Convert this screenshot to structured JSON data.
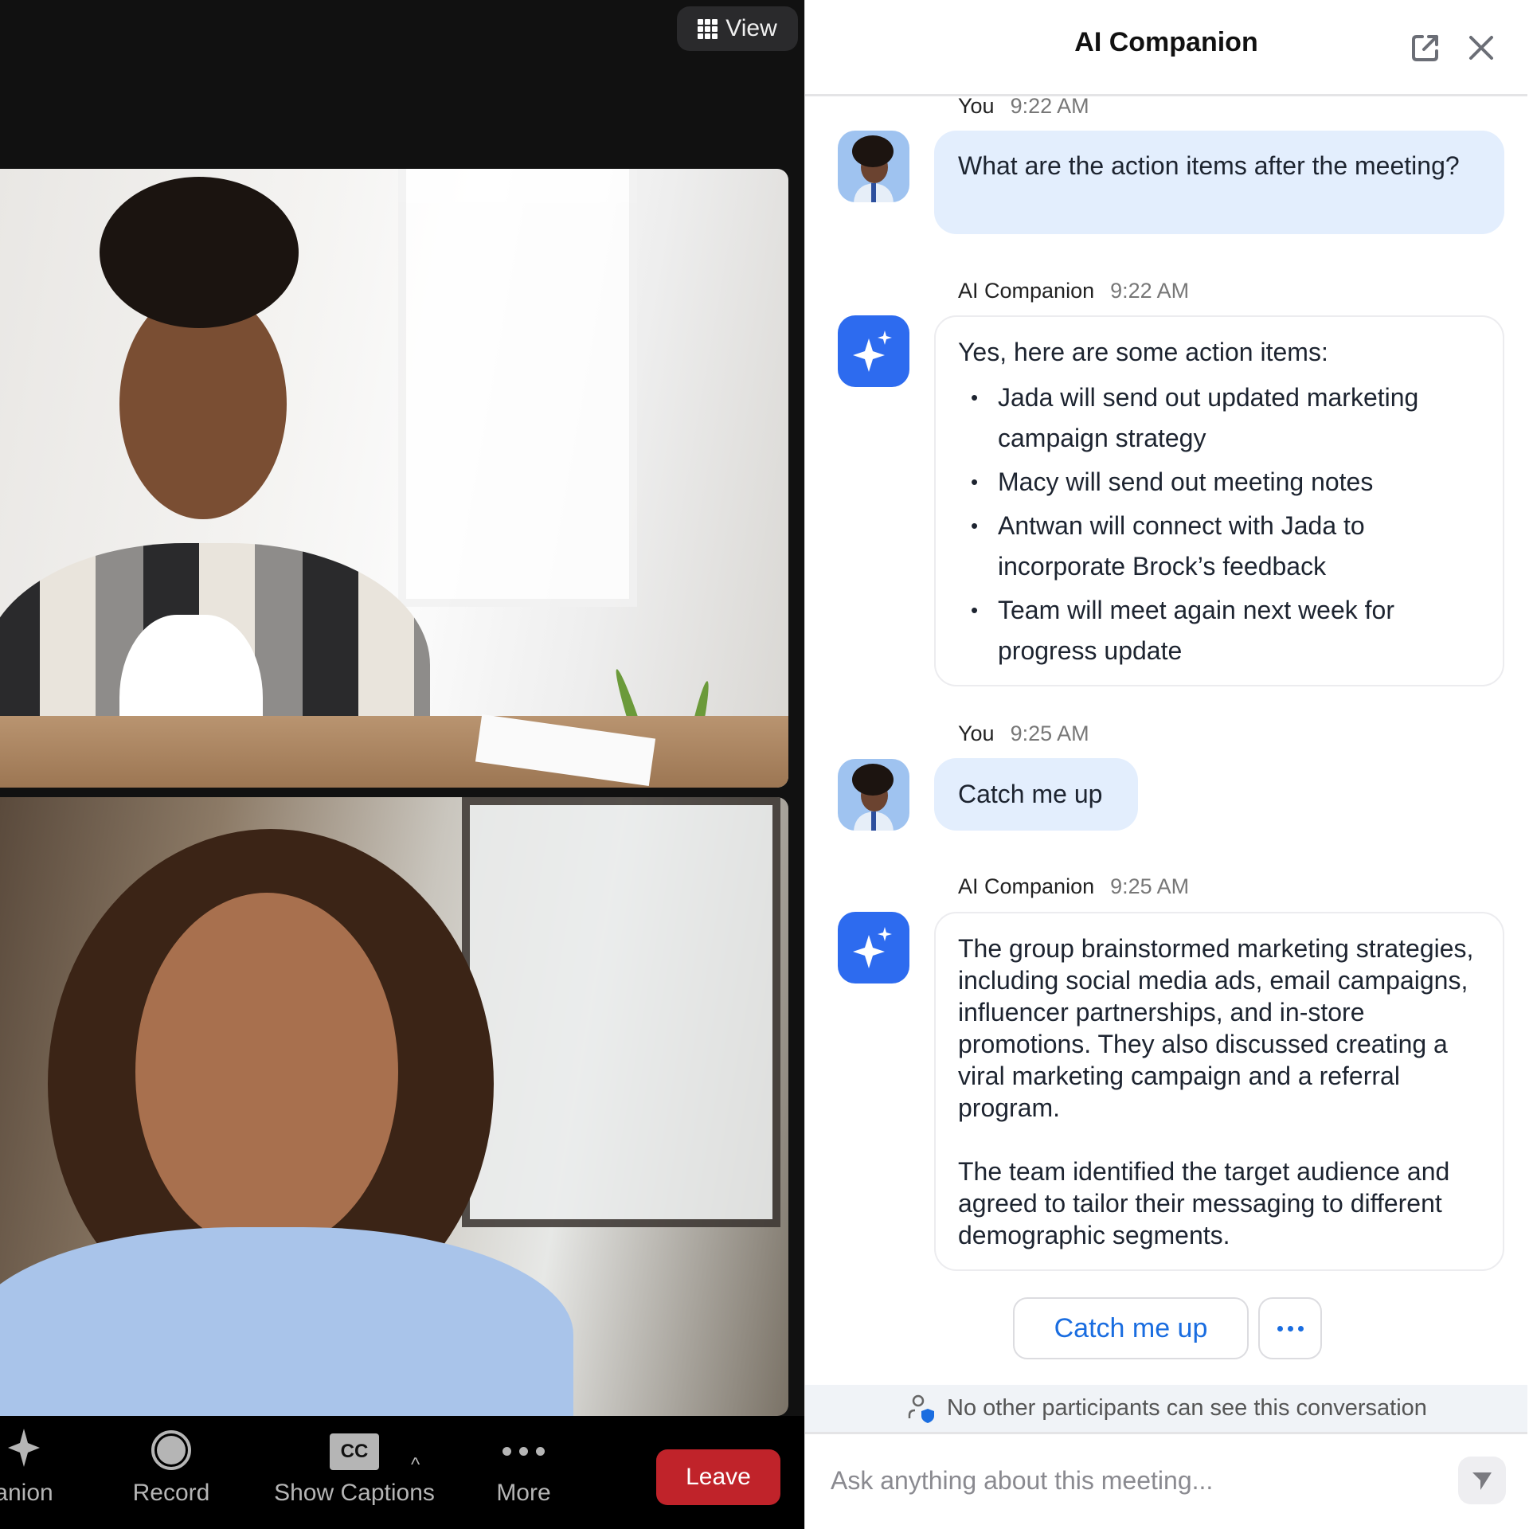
{
  "meeting": {
    "view_button": {
      "label": "View",
      "icon": "grid-icon"
    },
    "participants": [
      {
        "name": "participant-1",
        "description": "Woman with glasses in plaid shirt at desk"
      },
      {
        "name": "participant-2",
        "description": "Smiling woman in blue shirt"
      }
    ],
    "toolbar": {
      "items": [
        {
          "label": "anion",
          "icon": "sparkle-icon"
        },
        {
          "label": "Record",
          "icon": "record-icon"
        },
        {
          "label": "Show Captions",
          "icon": "cc-icon",
          "icon_text": "CC"
        },
        {
          "label": "More",
          "icon": "more-icon"
        }
      ],
      "caret": "^",
      "leave_label": "Leave",
      "leave_color": "#c0232a"
    }
  },
  "panel": {
    "title": "AI Companion",
    "accent": "#2d6bef",
    "messages": [
      {
        "sender": "You",
        "time": "9:22 AM",
        "text": "What are the action items after the meeting?"
      },
      {
        "sender": "AI Companion",
        "time": "9:22 AM",
        "intro": "Yes, here are some action items:",
        "items": [
          "Jada will send out updated marketing campaign strategy",
          "Macy will send out meeting notes",
          "Antwan will connect with Jada to incorporate Brock’s feedback",
          "Team will meet again next week for progress update"
        ]
      },
      {
        "sender": "You",
        "time": "9:25 AM",
        "text": "Catch me up"
      },
      {
        "sender": "AI Companion",
        "time": "9:25 AM",
        "paragraphs": [
          "The group brainstormed marketing strategies, including social media ads, email campaigns, influencer partnerships, and in-store promotions. They also discussed creating a viral marketing campaign and a referral program.",
          "The team identified the target audience and agreed to tailor their messaging to different demographic segments."
        ]
      }
    ],
    "suggestions": {
      "primary": "Catch me up",
      "more": "more-options"
    },
    "privacy_notice": "No other participants can see this conversation",
    "input": {
      "placeholder": "Ask anything about this meeting...",
      "value": ""
    }
  }
}
